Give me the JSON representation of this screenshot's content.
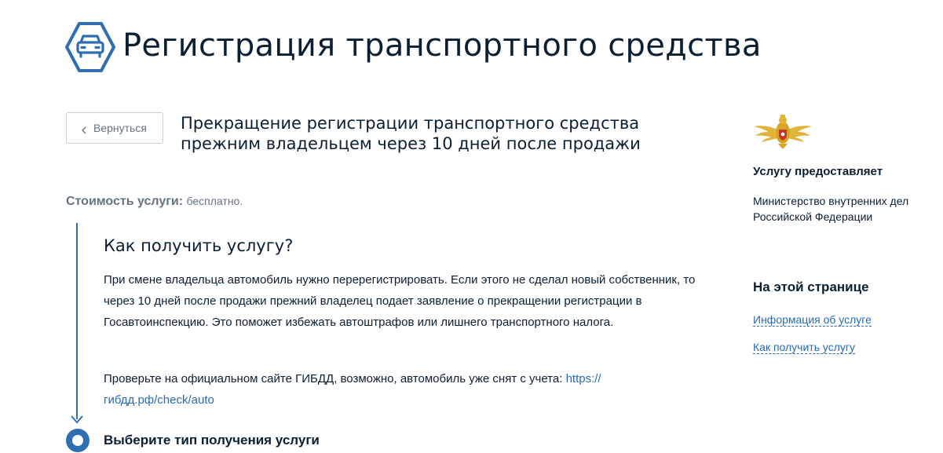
{
  "header": {
    "title": "Регистрация транспортного средства",
    "icon": "car-icon",
    "accent_color": "#2f6fb1"
  },
  "back_button": {
    "label": "Вернуться",
    "icon": "chevron-left-icon"
  },
  "service": {
    "subtitle_line1": "Прекращение регистрации транспортного средства",
    "subtitle_line2": "прежним владельцем через 10 дней после продажи",
    "cost_label": "Стоимость услуги:",
    "cost_value": "бесплатно."
  },
  "how": {
    "heading": "Как получить услугу?",
    "paragraph1": "При смене владельца автомобиль нужно перерегистрировать. Если этого не сделал новый собственник, то через 10 дней после продажи прежний владелец подает заявление о прекращении регистрации в Госавтоинспекцию. Это поможет избежать автоштрафов или лишнего транспортного налога.",
    "paragraph2_text": "Проверьте на официальном сайте ГИБДД, возможно, автомобиль уже снят с учета:",
    "paragraph2_link_line1": "https://",
    "paragraph2_link_line2": "гибдд.рф/check/auto",
    "step1_title": "Выберите тип получения услуги"
  },
  "sidebar": {
    "emblem": "mvd-emblem-icon",
    "provider_label": "Услугу предоставляет",
    "provider_name_line1": "Министерство внутренних дел",
    "provider_name_line2": "Российской Федерации",
    "toc_heading": "На этой странице",
    "toc_items": [
      {
        "label": "Информация об услуге"
      },
      {
        "label": "Как получить услугу"
      }
    ],
    "link_color": "#2a6ab3"
  }
}
